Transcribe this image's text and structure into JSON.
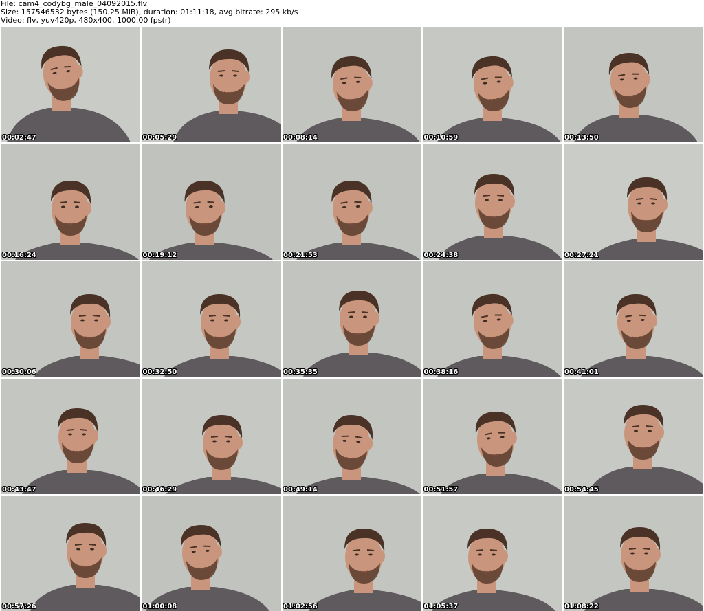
{
  "header": {
    "file_line": "File: cam4_codybg_male_04092015.flv",
    "size_line": "Size: 157546532 bytes (150.25 MiB), duration: 01:11:18, avg.bitrate: 295 kb/s",
    "video_line": "Video: flv, yuv420p, 480x400, 1000.00 fps(r)"
  },
  "thumbnails": [
    {
      "timestamp": "00:02:47"
    },
    {
      "timestamp": "00:05:29"
    },
    {
      "timestamp": "00:08:14"
    },
    {
      "timestamp": "00:10:59"
    },
    {
      "timestamp": "00:13:50"
    },
    {
      "timestamp": "00:16:24"
    },
    {
      "timestamp": "00:19:12"
    },
    {
      "timestamp": "00:21:53"
    },
    {
      "timestamp": "00:24:38"
    },
    {
      "timestamp": "00:27:21"
    },
    {
      "timestamp": "00:30:06"
    },
    {
      "timestamp": "00:32:50"
    },
    {
      "timestamp": "00:35:35"
    },
    {
      "timestamp": "00:38:16"
    },
    {
      "timestamp": "00:41:01"
    },
    {
      "timestamp": "00:43:47"
    },
    {
      "timestamp": "00:46:29"
    },
    {
      "timestamp": "00:49:14"
    },
    {
      "timestamp": "00:51:57"
    },
    {
      "timestamp": "00:54:45"
    },
    {
      "timestamp": "00:57:26"
    },
    {
      "timestamp": "01:00:08"
    },
    {
      "timestamp": "01:02:56"
    },
    {
      "timestamp": "01:05:37"
    },
    {
      "timestamp": "01:08:22"
    }
  ],
  "colors": {
    "background_wall": "#c4c8c2",
    "shirt": "#5e5a5e",
    "skin": "#c9967d",
    "hair": "#4a3226",
    "beard": "#5a3c2c",
    "timestamp_text": "#ffffff"
  }
}
